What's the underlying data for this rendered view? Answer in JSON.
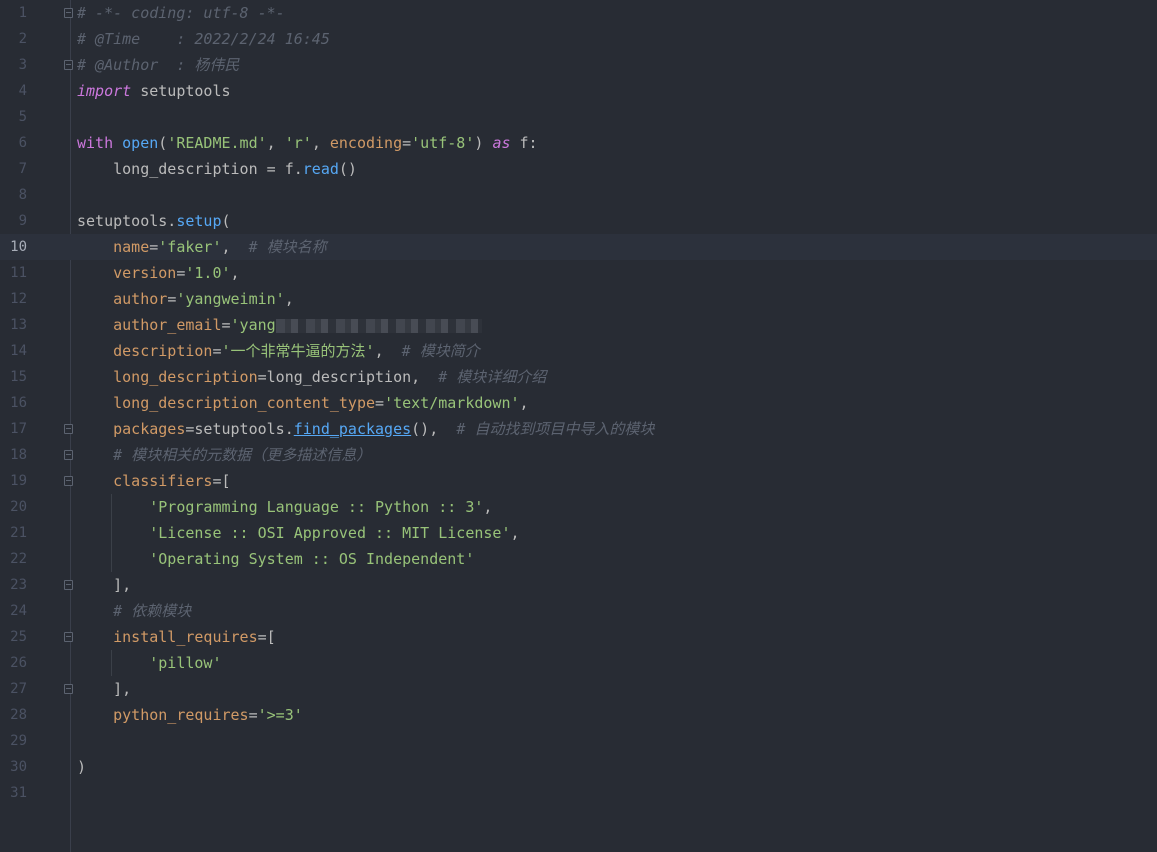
{
  "editor": {
    "current_line": 10,
    "lines": [
      {
        "n": "1",
        "fold": true,
        "tokens": [
          {
            "t": "# -*- coding: utf-8 -*-",
            "c": "cmt"
          }
        ]
      },
      {
        "n": "2",
        "fold": false,
        "tokens": [
          {
            "t": "# @Time    : 2022/2/24 16:45",
            "c": "cmt"
          }
        ]
      },
      {
        "n": "3",
        "fold": true,
        "tokens": [
          {
            "t": "# @Author  : 杨伟民",
            "c": "cmt"
          }
        ]
      },
      {
        "n": "4",
        "fold": false,
        "tokens": [
          {
            "t": "import",
            "c": "kwi"
          },
          {
            "t": " setuptools",
            "c": "txt"
          }
        ]
      },
      {
        "n": "5",
        "fold": false,
        "tokens": []
      },
      {
        "n": "6",
        "fold": false,
        "tokens": [
          {
            "t": "with",
            "c": "kw"
          },
          {
            "t": " ",
            "c": "txt"
          },
          {
            "t": "open",
            "c": "fn"
          },
          {
            "t": "(",
            "c": "txt"
          },
          {
            "t": "'README.md'",
            "c": "str"
          },
          {
            "t": ", ",
            "c": "txt"
          },
          {
            "t": "'r'",
            "c": "str"
          },
          {
            "t": ", ",
            "c": "txt"
          },
          {
            "t": "encoding",
            "c": "param"
          },
          {
            "t": "=",
            "c": "txt"
          },
          {
            "t": "'utf-8'",
            "c": "str"
          },
          {
            "t": ") ",
            "c": "txt"
          },
          {
            "t": "as",
            "c": "kwi"
          },
          {
            "t": " f:",
            "c": "txt"
          }
        ]
      },
      {
        "n": "7",
        "fold": false,
        "tokens": [
          {
            "t": "    long_description = f.",
            "c": "txt"
          },
          {
            "t": "read",
            "c": "fn"
          },
          {
            "t": "()",
            "c": "txt"
          }
        ]
      },
      {
        "n": "8",
        "fold": false,
        "tokens": []
      },
      {
        "n": "9",
        "fold": false,
        "tokens": [
          {
            "t": "setuptools.",
            "c": "txt"
          },
          {
            "t": "setup",
            "c": "fn"
          },
          {
            "t": "(",
            "c": "txt"
          }
        ]
      },
      {
        "n": "10",
        "fold": false,
        "tokens": [
          {
            "t": "    ",
            "c": "txt"
          },
          {
            "t": "name",
            "c": "param"
          },
          {
            "t": "=",
            "c": "txt"
          },
          {
            "t": "'faker'",
            "c": "str"
          },
          {
            "t": ",  ",
            "c": "txt"
          },
          {
            "t": "# 模块名称",
            "c": "cmt"
          }
        ]
      },
      {
        "n": "11",
        "fold": false,
        "tokens": [
          {
            "t": "    ",
            "c": "txt"
          },
          {
            "t": "version",
            "c": "param"
          },
          {
            "t": "=",
            "c": "txt"
          },
          {
            "t": "'1.0'",
            "c": "str"
          },
          {
            "t": ",",
            "c": "txt"
          }
        ]
      },
      {
        "n": "12",
        "fold": false,
        "tokens": [
          {
            "t": "    ",
            "c": "txt"
          },
          {
            "t": "author",
            "c": "param"
          },
          {
            "t": "=",
            "c": "txt"
          },
          {
            "t": "'yangweimin'",
            "c": "str"
          },
          {
            "t": ",",
            "c": "txt"
          }
        ]
      },
      {
        "n": "13",
        "fold": false,
        "tokens": [
          {
            "t": "    ",
            "c": "txt"
          },
          {
            "t": "author_email",
            "c": "param"
          },
          {
            "t": "=",
            "c": "txt"
          },
          {
            "t": "'yang",
            "c": "str"
          },
          {
            "t": "",
            "c": "blur"
          }
        ]
      },
      {
        "n": "14",
        "fold": false,
        "tokens": [
          {
            "t": "    ",
            "c": "txt"
          },
          {
            "t": "description",
            "c": "param"
          },
          {
            "t": "=",
            "c": "txt"
          },
          {
            "t": "'一个非常牛逼的方法'",
            "c": "str"
          },
          {
            "t": ",  ",
            "c": "txt"
          },
          {
            "t": "# 模块简介",
            "c": "cmt"
          }
        ]
      },
      {
        "n": "15",
        "fold": false,
        "tokens": [
          {
            "t": "    ",
            "c": "txt"
          },
          {
            "t": "long_description",
            "c": "param"
          },
          {
            "t": "=long_description,  ",
            "c": "txt"
          },
          {
            "t": "# 模块详细介绍",
            "c": "cmt"
          }
        ]
      },
      {
        "n": "16",
        "fold": false,
        "tokens": [
          {
            "t": "    ",
            "c": "txt"
          },
          {
            "t": "long_description_content_type",
            "c": "param"
          },
          {
            "t": "=",
            "c": "txt"
          },
          {
            "t": "'text/markdown'",
            "c": "str"
          },
          {
            "t": ",",
            "c": "txt"
          }
        ]
      },
      {
        "n": "17",
        "fold": true,
        "tokens": [
          {
            "t": "    ",
            "c": "txt"
          },
          {
            "t": "packages",
            "c": "param"
          },
          {
            "t": "=setuptools.",
            "c": "txt"
          },
          {
            "t": "find_packages",
            "c": "fn ul"
          },
          {
            "t": "(),  ",
            "c": "txt"
          },
          {
            "t": "# 自动找到项目中导入的模块",
            "c": "cmt"
          }
        ]
      },
      {
        "n": "18",
        "fold": true,
        "tokens": [
          {
            "t": "    ",
            "c": "txt"
          },
          {
            "t": "# 模块相关的元数据（更多描述信息）",
            "c": "cmt"
          }
        ]
      },
      {
        "n": "19",
        "fold": true,
        "tokens": [
          {
            "t": "    ",
            "c": "txt"
          },
          {
            "t": "classifiers",
            "c": "param"
          },
          {
            "t": "=[",
            "c": "txt"
          }
        ]
      },
      {
        "n": "20",
        "fold": false,
        "tokens": [
          {
            "t": "        ",
            "c": "txt"
          },
          {
            "t": "'Programming Language :: Python :: 3'",
            "c": "str"
          },
          {
            "t": ",",
            "c": "txt"
          }
        ]
      },
      {
        "n": "21",
        "fold": false,
        "tokens": [
          {
            "t": "        ",
            "c": "txt"
          },
          {
            "t": "'License :: OSI Approved :: MIT License'",
            "c": "str"
          },
          {
            "t": ",",
            "c": "txt"
          }
        ]
      },
      {
        "n": "22",
        "fold": false,
        "tokens": [
          {
            "t": "        ",
            "c": "txt"
          },
          {
            "t": "'Operating System :: OS Independent'",
            "c": "str"
          }
        ]
      },
      {
        "n": "23",
        "fold": true,
        "tokens": [
          {
            "t": "    ],",
            "c": "txt"
          }
        ]
      },
      {
        "n": "24",
        "fold": false,
        "tokens": [
          {
            "t": "    ",
            "c": "txt"
          },
          {
            "t": "# 依赖模块",
            "c": "cmt"
          }
        ]
      },
      {
        "n": "25",
        "fold": true,
        "tokens": [
          {
            "t": "    ",
            "c": "txt"
          },
          {
            "t": "install_requires",
            "c": "param"
          },
          {
            "t": "=[",
            "c": "txt"
          }
        ]
      },
      {
        "n": "26",
        "fold": false,
        "tokens": [
          {
            "t": "        ",
            "c": "txt"
          },
          {
            "t": "'pillow'",
            "c": "str"
          }
        ]
      },
      {
        "n": "27",
        "fold": true,
        "tokens": [
          {
            "t": "    ],",
            "c": "txt"
          }
        ]
      },
      {
        "n": "28",
        "fold": false,
        "tokens": [
          {
            "t": "    ",
            "c": "txt"
          },
          {
            "t": "python_requires",
            "c": "param"
          },
          {
            "t": "=",
            "c": "txt"
          },
          {
            "t": "'>=3'",
            "c": "str"
          }
        ]
      },
      {
        "n": "29",
        "fold": false,
        "tokens": []
      },
      {
        "n": "30",
        "fold": false,
        "tokens": [
          {
            "t": ")",
            "c": "txt"
          }
        ]
      },
      {
        "n": "31",
        "fold": false,
        "tokens": []
      }
    ]
  },
  "colors": {
    "background": "#282c34",
    "keyword": "#cc78dd",
    "function": "#56a8f5",
    "string": "#98c379",
    "parameter": "#d19a66",
    "comment": "#5c6370",
    "text": "#bbbbbb"
  }
}
